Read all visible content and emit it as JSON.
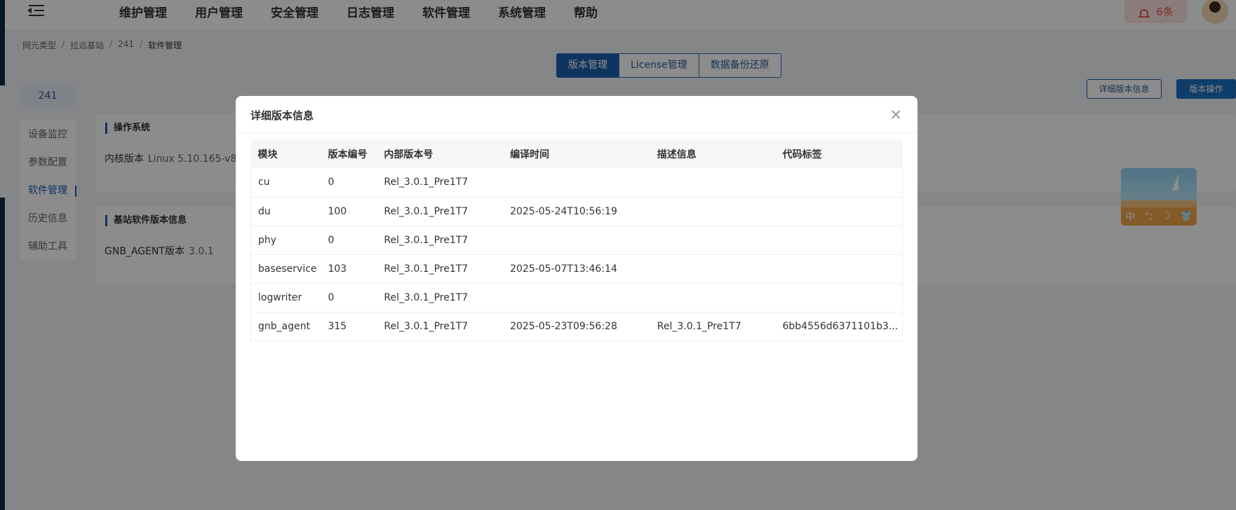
{
  "nav": {
    "items": [
      "维护管理",
      "用户管理",
      "安全管理",
      "日志管理",
      "软件管理",
      "系统管理",
      "帮助"
    ],
    "alarm_count": "6条"
  },
  "breadcrumb": [
    "网元类型",
    "拉远基站",
    "241",
    "软件管理"
  ],
  "tabs": [
    "版本管理",
    "License管理",
    "数据备份还原"
  ],
  "actions": {
    "detail": "详细版本信息",
    "operate": "版本操作"
  },
  "sidebar": {
    "ne_name": "241",
    "items": [
      "设备监控",
      "参数配置",
      "软件管理",
      "历史信息",
      "辅助工具"
    ]
  },
  "os_card": {
    "title": "操作系统",
    "label": "内核版本",
    "value": "Linux 5.10.165-v8"
  },
  "base_card": {
    "title": "基站软件版本信息",
    "label": "GNB_AGENT版本",
    "value": "3.0.1"
  },
  "widget": {
    "glyphs": [
      "中",
      "°;",
      "☽",
      "👕"
    ]
  },
  "modal": {
    "title": "详细版本信息",
    "columns": [
      "模块",
      "版本编号",
      "内部版本号",
      "编译时间",
      "描述信息",
      "代码标签"
    ],
    "rows": [
      [
        "cu",
        "0",
        "Rel_3.0.1_Pre1T7",
        "",
        "",
        ""
      ],
      [
        "du",
        "100",
        "Rel_3.0.1_Pre1T7",
        "2025-05-24T10:56:19",
        "",
        ""
      ],
      [
        "phy",
        "0",
        "Rel_3.0.1_Pre1T7",
        "",
        "",
        ""
      ],
      [
        "baseservice",
        "103",
        "Rel_3.0.1_Pre1T7",
        "2025-05-07T13:46:14",
        "",
        ""
      ],
      [
        "logwriter",
        "0",
        "Rel_3.0.1_Pre1T7",
        "",
        "",
        ""
      ],
      [
        "gnb_agent",
        "315",
        "Rel_3.0.1_Pre1T7",
        "2025-05-23T09:56:28",
        "Rel_3.0.1_Pre1T7",
        "6bb4556d6371101b3..."
      ]
    ]
  }
}
